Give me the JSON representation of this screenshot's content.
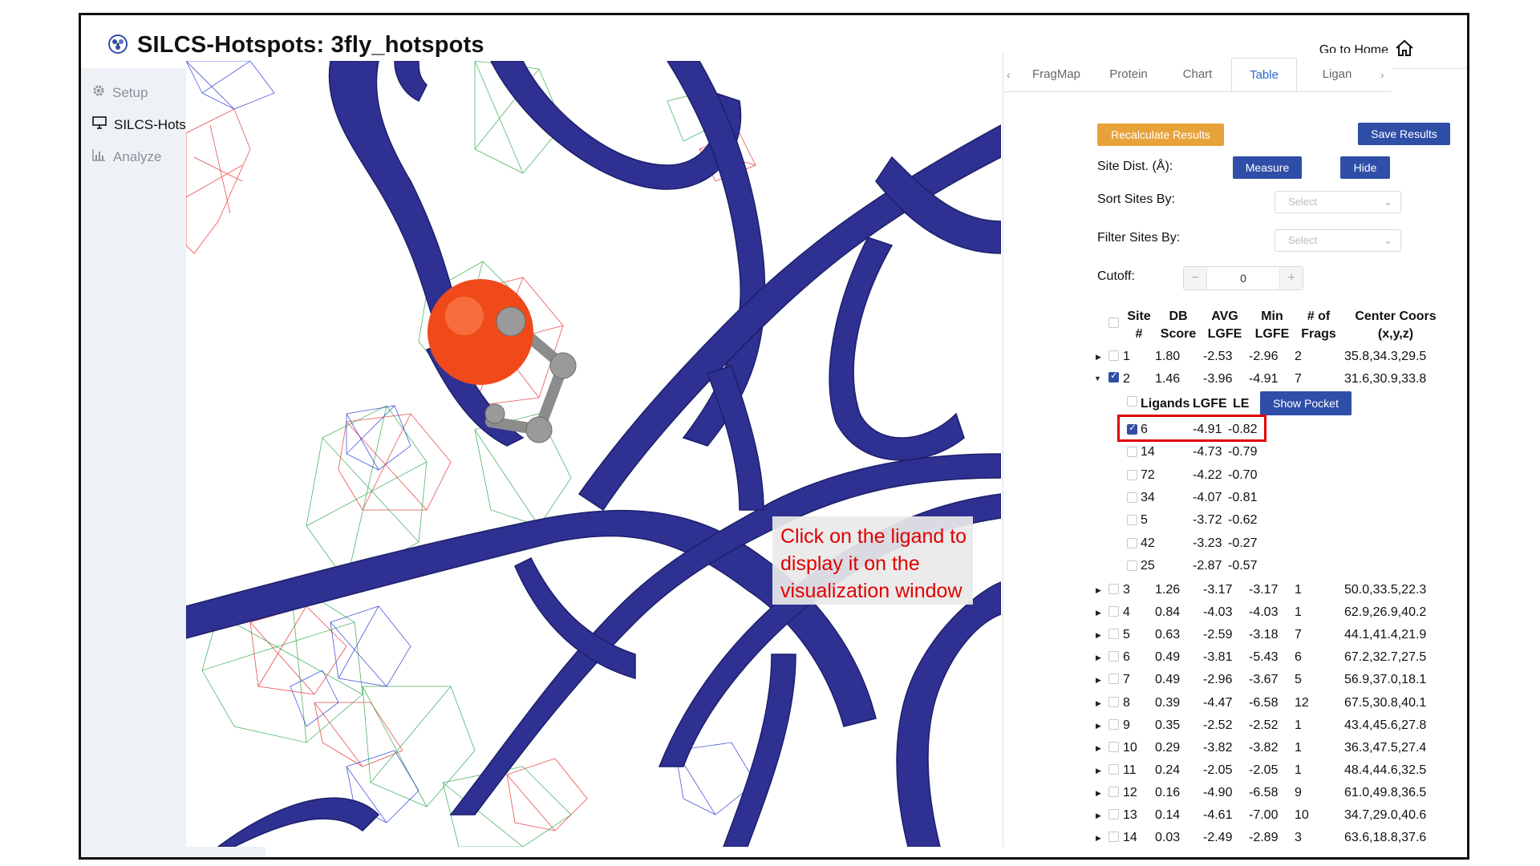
{
  "header": {
    "title": "SILCS-Hotspots: 3fly_hotspots",
    "go_home": "Go to Home"
  },
  "sidebar": {
    "items": [
      {
        "label": "Setup",
        "icon": "gear-icon"
      },
      {
        "label": "SILCS-Hotspots",
        "icon": "monitor-icon"
      },
      {
        "label": "Analyze",
        "icon": "bar-chart-icon"
      }
    ]
  },
  "tabs": {
    "items": [
      "FragMap",
      "Protein",
      "Chart",
      "Table",
      "Ligan"
    ],
    "active": "Table"
  },
  "controls": {
    "recalculate": "Recalculate Results",
    "save": "Save Results",
    "site_dist_label": "Site Dist. (Å):",
    "measure": "Measure",
    "hide": "Hide",
    "sort_label": "Sort Sites By:",
    "sort_placeholder": "Select",
    "filter_label": "Filter Sites By:",
    "filter_placeholder": "Select",
    "cutoff_label": "Cutoff:",
    "cutoff_value": "0",
    "minus": "−",
    "plus": "+"
  },
  "table": {
    "headers": [
      "Site\n#",
      "DB\nScore",
      "AVG\nLGFE",
      "Min\nLGFE",
      "# of\nFrags",
      "Center Coors\n(x,y,z)"
    ],
    "rows_top": [
      {
        "site": "1",
        "db": "1.80",
        "avg": "-2.53",
        "min": "-2.96",
        "frags": "2",
        "center": "35.8,34.3,29.5",
        "checked": false,
        "expanded": false
      },
      {
        "site": "2",
        "db": "1.46",
        "avg": "-3.96",
        "min": "-4.91",
        "frags": "7",
        "center": "31.6,30.9,33.8",
        "checked": true,
        "expanded": true
      }
    ],
    "ligands": {
      "headers": {
        "ligands": "Ligands",
        "lgfe": "LGFE",
        "le": "LE"
      },
      "show_pocket": "Show Pocket",
      "rows": [
        {
          "id": "6",
          "lgfe": "-4.91",
          "le": "-0.82",
          "checked": true
        },
        {
          "id": "14",
          "lgfe": "-4.73",
          "le": "-0.79",
          "checked": false
        },
        {
          "id": "72",
          "lgfe": "-4.22",
          "le": "-0.70",
          "checked": false
        },
        {
          "id": "34",
          "lgfe": "-4.07",
          "le": "-0.81",
          "checked": false
        },
        {
          "id": "5",
          "lgfe": "-3.72",
          "le": "-0.62",
          "checked": false
        },
        {
          "id": "42",
          "lgfe": "-3.23",
          "le": "-0.27",
          "checked": false
        },
        {
          "id": "25",
          "lgfe": "-2.87",
          "le": "-0.57",
          "checked": false
        }
      ]
    },
    "rows_bottom": [
      {
        "site": "3",
        "db": "1.26",
        "avg": "-3.17",
        "min": "-3.17",
        "frags": "1",
        "center": "50.0,33.5,22.3"
      },
      {
        "site": "4",
        "db": "0.84",
        "avg": "-4.03",
        "min": "-4.03",
        "frags": "1",
        "center": "62.9,26.9,40.2"
      },
      {
        "site": "5",
        "db": "0.63",
        "avg": "-2.59",
        "min": "-3.18",
        "frags": "7",
        "center": "44.1,41.4,21.9"
      },
      {
        "site": "6",
        "db": "0.49",
        "avg": "-3.81",
        "min": "-5.43",
        "frags": "6",
        "center": "67.2,32.7,27.5"
      },
      {
        "site": "7",
        "db": "0.49",
        "avg": "-2.96",
        "min": "-3.67",
        "frags": "5",
        "center": "56.9,37.0,18.1"
      },
      {
        "site": "8",
        "db": "0.39",
        "avg": "-4.47",
        "min": "-6.58",
        "frags": "12",
        "center": "67.5,30.8,40.1"
      },
      {
        "site": "9",
        "db": "0.35",
        "avg": "-2.52",
        "min": "-2.52",
        "frags": "1",
        "center": "43.4,45.6,27.8"
      },
      {
        "site": "10",
        "db": "0.29",
        "avg": "-3.82",
        "min": "-3.82",
        "frags": "1",
        "center": "36.3,47.5,27.4"
      },
      {
        "site": "11",
        "db": "0.24",
        "avg": "-2.05",
        "min": "-2.05",
        "frags": "1",
        "center": "48.4,44.6,32.5"
      },
      {
        "site": "12",
        "db": "0.16",
        "avg": "-4.90",
        "min": "-6.58",
        "frags": "9",
        "center": "61.0,49.8,36.5"
      },
      {
        "site": "13",
        "db": "0.14",
        "avg": "-4.61",
        "min": "-7.00",
        "frags": "10",
        "center": "34.7,29.0,40.6"
      },
      {
        "site": "14",
        "db": "0.03",
        "avg": "-2.49",
        "min": "-2.89",
        "frags": "3",
        "center": "63.6,18.8,37.6"
      }
    ]
  },
  "annotation": {
    "text": "Click on the ligand to display it on the visualization window",
    "color": "#e00000"
  },
  "colors": {
    "ribbon": "#2e3192",
    "fragmap_red": "#e53030",
    "fragmap_green": "#2fa84f",
    "fragmap_blue": "#2a3bd6",
    "atom": "#f04a1a",
    "accent_blue": "#2f4ea8",
    "accent_orange": "#e8a23a"
  }
}
